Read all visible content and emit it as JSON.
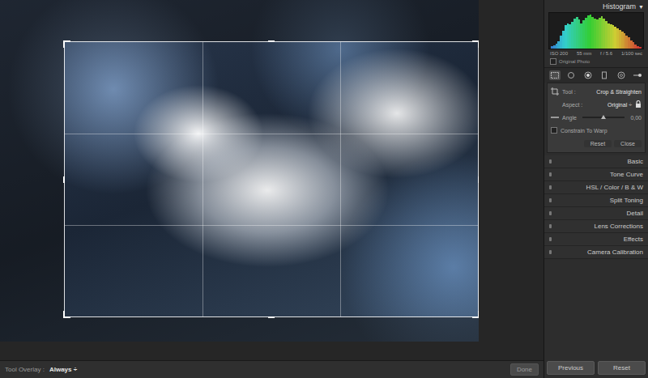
{
  "histogram": {
    "title": "Histogram",
    "toggle": "▼",
    "values": [
      5,
      8,
      12,
      18,
      30,
      42,
      55,
      60,
      58,
      62,
      70,
      75,
      68,
      60,
      66,
      72,
      78,
      80,
      74,
      70,
      68,
      72,
      76,
      70,
      64,
      60,
      58,
      55,
      52,
      48,
      44,
      40,
      36,
      30,
      26,
      20,
      15,
      10,
      6,
      3
    ],
    "meta": [
      "ISO 200",
      "55 mm",
      "f / 5.6",
      "1/100 sec"
    ],
    "original_photo": {
      "label": "Original Photo",
      "checked": false
    }
  },
  "tools": [
    {
      "kind": "crop",
      "selected": true
    },
    {
      "kind": "spot",
      "selected": false
    },
    {
      "kind": "redeye",
      "selected": false
    },
    {
      "kind": "graduated",
      "selected": false
    },
    {
      "kind": "radial",
      "selected": false
    },
    {
      "kind": "brush",
      "selected": false
    }
  ],
  "crop_panel": {
    "tool_label": "Tool :",
    "tool_name": "Crop & Straighten",
    "aspect_label": "Aspect :",
    "aspect_value": "Original ÷",
    "locked": true,
    "angle_label": "Angle",
    "angle_level": 0.5,
    "angle_value": "0,00",
    "constrain": {
      "label": "Constrain To Warp",
      "checked": false
    },
    "buttons": [
      "Reset",
      "Close"
    ]
  },
  "panels": [
    {
      "label": "Basic"
    },
    {
      "label": "Tone Curve"
    },
    {
      "label": "HSL / Color / B & W"
    },
    {
      "label": "Split Toning"
    },
    {
      "label": "Detail"
    },
    {
      "label": "Lens Corrections"
    },
    {
      "label": "Effects"
    },
    {
      "label": "Camera Calibration"
    }
  ],
  "toolbar": {
    "overlay_label": "Tool Overlay :",
    "overlay_value": "Always ÷",
    "done": "Done"
  },
  "footer_buttons": [
    "Previous",
    "Reset"
  ]
}
